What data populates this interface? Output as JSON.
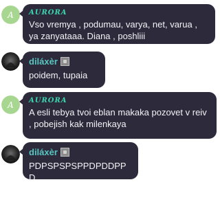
{
  "messages": [
    {
      "author": "AURORA",
      "text": "Vso vremya , podumau, varya, net, varua , ya zanyataaa. Diana , poshliii"
    },
    {
      "author": "diláxèr",
      "text": "poidem,  tupaia"
    },
    {
      "author": "AURORA",
      "text": "A esli tebya tvoi eblan makaka pozovet v reiv , pobejish kak milenkaya"
    },
    {
      "author": "diláxèr",
      "text": "PDPSPSPSPPDPDDPPD"
    }
  ],
  "colors": {
    "bubble": "#2d2a3c",
    "aurora_name": "#3bd6ad",
    "dilaxer_name": "#58c6c0",
    "aurora_avatar": "#a7d690"
  },
  "icons": {
    "aurora_avatar": "green-letter-avatar",
    "dilaxer_avatar": "dark-photo-avatar",
    "badge": "badge-icon"
  }
}
